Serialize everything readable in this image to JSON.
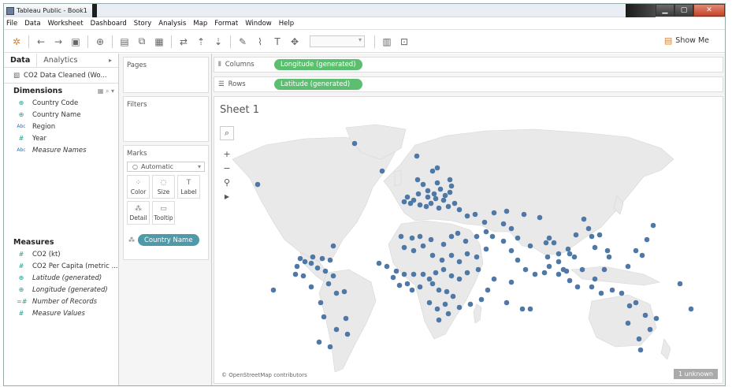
{
  "window": {
    "title": "Tableau Public - Book1"
  },
  "menu": [
    "File",
    "Data",
    "Worksheet",
    "Dashboard",
    "Story",
    "Analysis",
    "Map",
    "Format",
    "Window",
    "Help"
  ],
  "toolbar": {
    "show_me": "Show Me"
  },
  "left": {
    "tab_data": "Data",
    "tab_analytics": "Analytics",
    "datasource": "CO2 Data Cleaned (Wo...",
    "dimensions_label": "Dimensions",
    "dimensions": [
      {
        "label": "Country Code",
        "icon": "globe-icon",
        "italic": false
      },
      {
        "label": "Country Name",
        "icon": "globe-icon",
        "italic": false
      },
      {
        "label": "Region",
        "icon": "abc-icon",
        "italic": false
      },
      {
        "label": "Year",
        "icon": "hash-icon",
        "italic": false
      },
      {
        "label": "Measure Names",
        "icon": "abc-icon",
        "italic": true
      }
    ],
    "measures_label": "Measures",
    "measures": [
      {
        "label": "CO2 (kt)",
        "icon": "hash-icon",
        "italic": false
      },
      {
        "label": "CO2 Per Capita (metric ...",
        "icon": "hash-icon",
        "italic": false
      },
      {
        "label": "Latitude (generated)",
        "icon": "globe-icon",
        "italic": true
      },
      {
        "label": "Longitude (generated)",
        "icon": "globe-icon",
        "italic": true
      },
      {
        "label": "Number of Records",
        "icon": "hash-icon",
        "italic": true
      },
      {
        "label": "Measure Values",
        "icon": "hash-icon",
        "italic": true
      }
    ]
  },
  "cards": {
    "pages": "Pages",
    "filters": "Filters",
    "marks": "Marks",
    "mark_type": "Automatic",
    "mark_buttons": [
      "Color",
      "Size",
      "Label",
      "Detail",
      "Tooltip"
    ],
    "detail_pill": "Country Name"
  },
  "shelves": {
    "columns_label": "Columns",
    "columns_pill": "Longitude (generated)",
    "rows_label": "Rows",
    "rows_pill": "Latitude (generated)"
  },
  "sheet": {
    "title": "Sheet 1",
    "attribution": "© OpenStreetMap contributors",
    "unknown": "1 unknown"
  },
  "colors": {
    "mark": "#4e79a7",
    "pill_green": "#5bbf6f",
    "pill_teal": "#4e9aa8"
  }
}
